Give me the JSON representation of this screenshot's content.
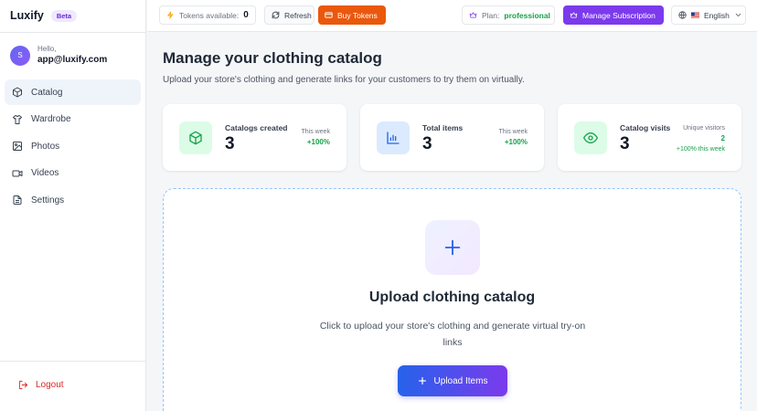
{
  "brand": {
    "name": "Luxify",
    "badge": "Beta"
  },
  "user": {
    "initial": "S",
    "greeting": "Hello,",
    "email": "app@luxify.com"
  },
  "sidebar": {
    "items": [
      {
        "label": "Catalog",
        "icon": "box-icon",
        "active": true
      },
      {
        "label": "Wardrobe",
        "icon": "shirt-icon",
        "active": false
      },
      {
        "label": "Photos",
        "icon": "image-icon",
        "active": false
      },
      {
        "label": "Videos",
        "icon": "video-icon",
        "active": false
      },
      {
        "label": "Settings",
        "icon": "settings-icon",
        "active": false
      }
    ],
    "logout": "Logout"
  },
  "header": {
    "tokens_label": "Tokens available:",
    "tokens_value": "0",
    "refresh": "Refresh",
    "buy": "Buy Tokens",
    "plan_label": "Plan:",
    "plan_value": "professional",
    "manage": "Manage Subscription",
    "language": "English"
  },
  "main": {
    "title": "Manage your clothing catalog",
    "subtitle": "Upload your store's clothing and generate links for your customers to try them on virtually.",
    "cards": [
      {
        "label": "Catalogs created",
        "value": "3",
        "sublabel": "This week",
        "delta": "+100%",
        "icon": "box-icon"
      },
      {
        "label": "Total items",
        "value": "3",
        "sublabel": "This week",
        "delta": "+100%",
        "icon": "bar-chart-icon"
      },
      {
        "label": "Catalog visits",
        "value": "3",
        "sublabel": "Unique visitors",
        "delta": "2",
        "delta2": "+100% this week",
        "icon": "eye-icon"
      }
    ],
    "upload": {
      "title": "Upload clothing catalog",
      "description": "Click to upload your store's clothing and generate virtual try-on links",
      "button": "Upload Items"
    }
  },
  "colors": {
    "accent": "#7c3aed",
    "buy": "#ea580c",
    "positive": "#16a34a",
    "logout": "#dc2626"
  }
}
